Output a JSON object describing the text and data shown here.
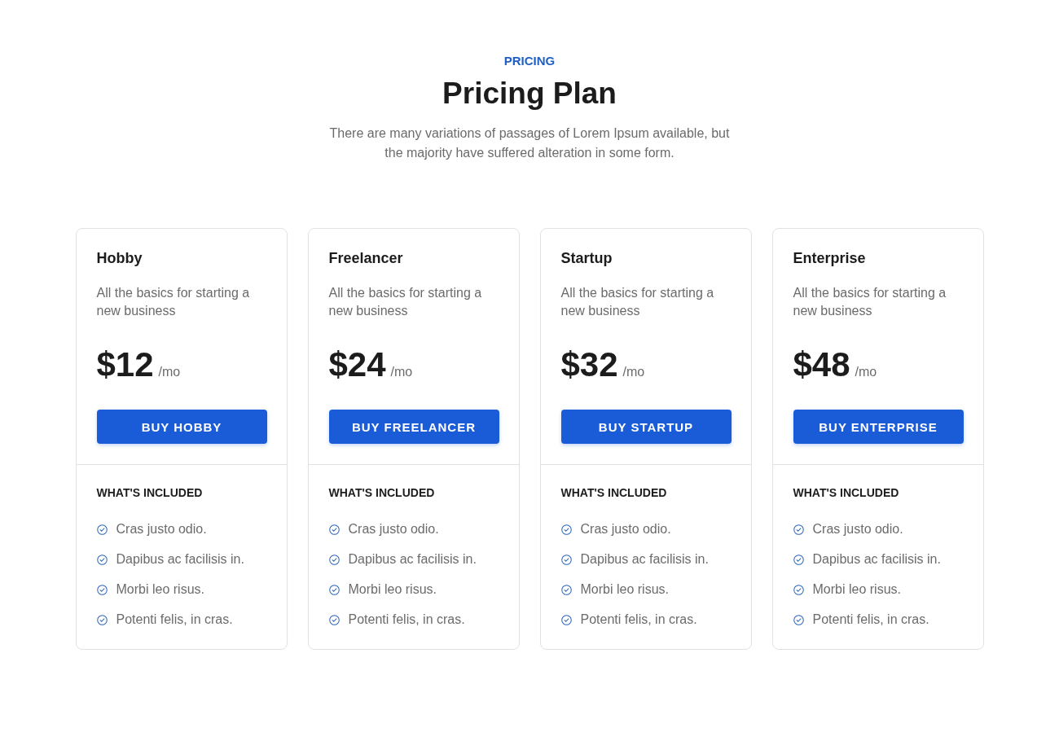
{
  "header": {
    "eyebrow": "PRICING",
    "title": "Pricing Plan",
    "subtitle": "There are many variations of passages of Lorem Ipsum available, but the majority have suffered alteration in some form."
  },
  "plans": [
    {
      "name": "Hobby",
      "description": "All the basics for starting a new business",
      "price": "$12",
      "period": "/mo",
      "button": "BUY HOBBY",
      "included_heading": "WHAT'S INCLUDED",
      "features": [
        "Cras justo odio.",
        "Dapibus ac facilisis in.",
        "Morbi leo risus.",
        "Potenti felis, in cras."
      ]
    },
    {
      "name": "Freelancer",
      "description": "All the basics for starting a new business",
      "price": "$24",
      "period": "/mo",
      "button": "BUY FREELANCER",
      "included_heading": "WHAT'S INCLUDED",
      "features": [
        "Cras justo odio.",
        "Dapibus ac facilisis in.",
        "Morbi leo risus.",
        "Potenti felis, in cras."
      ]
    },
    {
      "name": "Startup",
      "description": "All the basics for starting a new business",
      "price": "$32",
      "period": "/mo",
      "button": "BUY STARTUP",
      "included_heading": "WHAT'S INCLUDED",
      "features": [
        "Cras justo odio.",
        "Dapibus ac facilisis in.",
        "Morbi leo risus.",
        "Potenti felis, in cras."
      ]
    },
    {
      "name": "Enterprise",
      "description": "All the basics for starting a new business",
      "price": "$48",
      "period": "/mo",
      "button": "BUY ENTERPRISE",
      "included_heading": "WHAT'S INCLUDED",
      "features": [
        "Cras justo odio.",
        "Dapibus ac facilisis in.",
        "Morbi leo risus.",
        "Potenti felis, in cras."
      ]
    }
  ]
}
